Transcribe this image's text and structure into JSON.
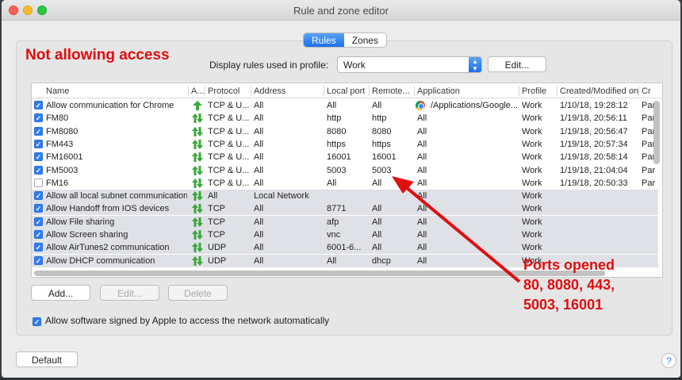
{
  "window": {
    "title": "Rule and zone editor"
  },
  "tabs": [
    {
      "label": "Rules",
      "active": true
    },
    {
      "label": "Zones",
      "active": false
    }
  ],
  "annotation_top": "Not allowing access",
  "profile": {
    "label": "Display rules used in profile:",
    "selected": "Work",
    "edit_label": "Edit..."
  },
  "columns": [
    "Name",
    "A...",
    "Protocol",
    "Address",
    "Local port",
    "Remote...",
    "Application",
    "Profile",
    "Created/Modified on",
    "Cr"
  ],
  "rows": [
    {
      "checked": true,
      "name": "Allow communication for Chrome",
      "protocol": "TCP & U...",
      "address": "All",
      "local_port": "All",
      "remote_port": "All",
      "application": "/Applications/Google...",
      "profile": "Work",
      "created": "1/10/18, 19:28:12",
      "creator": "Par",
      "shaded": false,
      "direction": "up",
      "has_app_icon": true
    },
    {
      "checked": true,
      "name": "FM80",
      "protocol": "TCP & U...",
      "address": "All",
      "local_port": "http",
      "remote_port": "http",
      "application": "All",
      "profile": "Work",
      "created": "1/19/18, 20:56:11",
      "creator": "Par",
      "shaded": false,
      "direction": "both"
    },
    {
      "checked": true,
      "name": "FM8080",
      "protocol": "TCP & U...",
      "address": "All",
      "local_port": "8080",
      "remote_port": "8080",
      "application": "All",
      "profile": "Work",
      "created": "1/19/18, 20:56:47",
      "creator": "Par",
      "shaded": false,
      "direction": "both"
    },
    {
      "checked": true,
      "name": "FM443",
      "protocol": "TCP & U...",
      "address": "All",
      "local_port": "https",
      "remote_port": "https",
      "application": "All",
      "profile": "Work",
      "created": "1/19/18, 20:57:34",
      "creator": "Par",
      "shaded": false,
      "direction": "both"
    },
    {
      "checked": true,
      "name": "FM16001",
      "protocol": "TCP & U...",
      "address": "All",
      "local_port": "16001",
      "remote_port": "16001",
      "application": "All",
      "profile": "Work",
      "created": "1/19/18, 20:58:14",
      "creator": "Par",
      "shaded": false,
      "direction": "both"
    },
    {
      "checked": true,
      "name": "FM5003",
      "protocol": "TCP & U...",
      "address": "All",
      "local_port": "5003",
      "remote_port": "5003",
      "application": "All",
      "profile": "Work",
      "created": "1/19/18, 21:04:04",
      "creator": "Par",
      "shaded": false,
      "direction": "both"
    },
    {
      "checked": false,
      "name": "FM16",
      "protocol": "TCP & U...",
      "address": "All",
      "local_port": "All",
      "remote_port": "All",
      "application": "All",
      "profile": "Work",
      "created": "1/19/18, 20:50:33",
      "creator": "Par",
      "shaded": false,
      "direction": "both"
    },
    {
      "checked": true,
      "name": "Allow all local subnet communication",
      "protocol": "All",
      "address": "Local Network",
      "local_port": "",
      "remote_port": "",
      "application": "All",
      "profile": "Work",
      "created": "",
      "creator": "",
      "shaded": true,
      "direction": "both"
    },
    {
      "checked": true,
      "name": "Allow Handoff from IOS devices",
      "protocol": "TCP",
      "address": "All",
      "local_port": "8771",
      "remote_port": "All",
      "application": "All",
      "profile": "Work",
      "created": "",
      "creator": "",
      "shaded": true,
      "direction": "both"
    },
    {
      "checked": true,
      "name": "Allow File sharing",
      "protocol": "TCP",
      "address": "All",
      "local_port": "afp",
      "remote_port": "All",
      "application": "All",
      "profile": "Work",
      "created": "",
      "creator": "",
      "shaded": true,
      "direction": "both"
    },
    {
      "checked": true,
      "name": "Allow Screen sharing",
      "protocol": "TCP",
      "address": "All",
      "local_port": "vnc",
      "remote_port": "All",
      "application": "All",
      "profile": "Work",
      "created": "",
      "creator": "",
      "shaded": true,
      "direction": "both"
    },
    {
      "checked": true,
      "name": "Allow AirTunes2 communication",
      "protocol": "UDP",
      "address": "All",
      "local_port": "6001-6...",
      "remote_port": "All",
      "application": "All",
      "profile": "Work",
      "created": "",
      "creator": "",
      "shaded": true,
      "direction": "both"
    },
    {
      "checked": true,
      "name": "Allow DHCP communication",
      "protocol": "UDP",
      "address": "All",
      "local_port": "All",
      "remote_port": "dhcp",
      "application": "All",
      "profile": "Work",
      "created": "",
      "creator": "",
      "shaded": true,
      "direction": "both"
    }
  ],
  "buttons": {
    "add": "Add...",
    "edit": "Edit...",
    "delete": "Delete",
    "default": "Default",
    "help": "?"
  },
  "allow_signed": {
    "checked": true,
    "label": "Allow software signed by Apple to access the network automatically"
  },
  "annotation_ports": [
    "Ports opened",
    "80, 8080, 443,",
    "5003, 16001"
  ],
  "colors": {
    "accent": "#2f7cf6",
    "annotation": "#e00d0d",
    "direction_arrow": "#3aa83a"
  }
}
